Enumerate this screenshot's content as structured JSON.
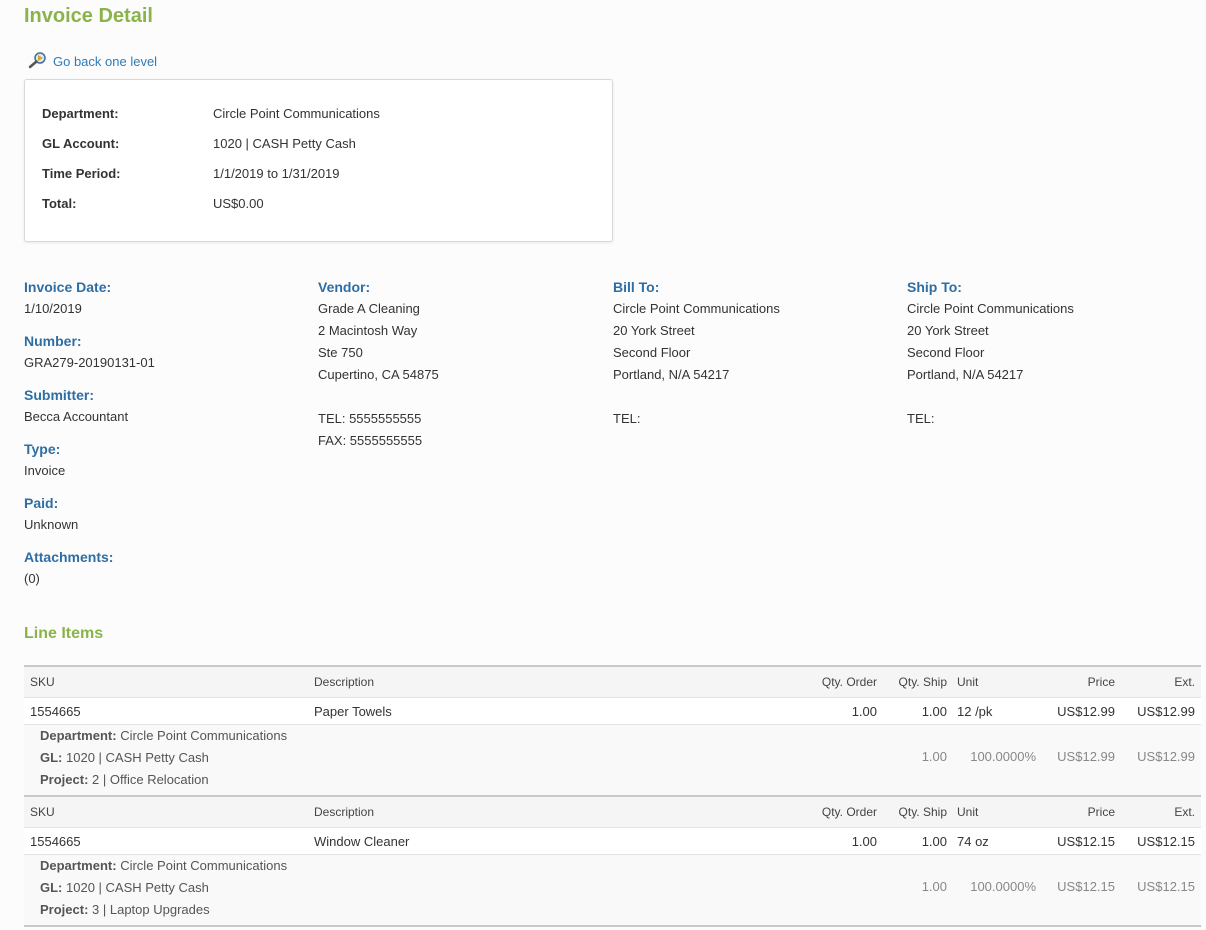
{
  "page": {
    "title": "Invoice Detail",
    "back_label": "Go back one level"
  },
  "summary": {
    "rows": [
      {
        "label": "Department:",
        "value": "Circle Point Communications"
      },
      {
        "label": "GL Account:",
        "value": "1020 | CASH Petty Cash"
      },
      {
        "label": "Time Period:",
        "value": "1/1/2019 to 1/31/2019"
      },
      {
        "label": "Total:",
        "value": "US$0.00"
      }
    ]
  },
  "invoice": {
    "date_label": "Invoice Date:",
    "date": "1/10/2019",
    "number_label": "Number:",
    "number": "GRA279-20190131-01",
    "submitter_label": "Submitter:",
    "submitter": "Becca Accountant",
    "type_label": "Type:",
    "type": "Invoice",
    "paid_label": "Paid:",
    "paid": "Unknown",
    "attachments_label": "Attachments:",
    "attachments": "(0)"
  },
  "vendor": {
    "label": "Vendor:",
    "name": "Grade A Cleaning",
    "line1": "2 Macintosh Way",
    "line2": "Ste 750",
    "line3": "Cupertino, CA 54875",
    "tel": "TEL: 5555555555",
    "fax": "FAX: 5555555555"
  },
  "bill_to": {
    "label": "Bill To:",
    "name": "Circle Point Communications",
    "line1": "20 York Street",
    "line2": "Second Floor",
    "line3": "Portland, N/A 54217",
    "tel": "TEL:"
  },
  "ship_to": {
    "label": "Ship To:",
    "name": "Circle Point Communications",
    "line1": "20 York Street",
    "line2": "Second Floor",
    "line3": "Portland, N/A 54217",
    "tel": "TEL:"
  },
  "line_items": {
    "title": "Line Items",
    "headers": {
      "sku": "SKU",
      "description": "Description",
      "qty_order": "Qty. Order",
      "qty_ship": "Qty. Ship",
      "unit": "Unit",
      "price": "Price",
      "ext": "Ext."
    },
    "items": [
      {
        "sku": "1554665",
        "description": "Paper Towels",
        "qty_order": "1.00",
        "qty_ship": "1.00",
        "unit": "12 /pk",
        "price": "US$12.99",
        "ext": "US$12.99",
        "dept_label": "Department:",
        "dept": "Circle Point Communications",
        "gl_label": "GL:",
        "gl": "1020 | CASH Petty Cash",
        "project_label": "Project:",
        "project": "2 | Office Relocation",
        "alloc_qty": "1.00",
        "alloc_pct": "100.0000%",
        "alloc_price": "US$12.99",
        "alloc_ext": "US$12.99"
      },
      {
        "sku": "1554665",
        "description": "Window Cleaner",
        "qty_order": "1.00",
        "qty_ship": "1.00",
        "unit": "74 oz",
        "price": "US$12.15",
        "ext": "US$12.15",
        "dept_label": "Department:",
        "dept": "Circle Point Communications",
        "gl_label": "GL:",
        "gl": "1020 | CASH Petty Cash",
        "project_label": "Project:",
        "project": "3 | Laptop Upgrades",
        "alloc_qty": "1.00",
        "alloc_pct": "100.0000%",
        "alloc_price": "US$12.15",
        "alloc_ext": "US$12.15"
      }
    ]
  },
  "colors": {
    "accent_green": "#8ab44a",
    "label_blue": "#2f6ea4",
    "link_blue": "#2f7bb8"
  },
  "icons": {
    "back": "magnifier-back-icon"
  }
}
